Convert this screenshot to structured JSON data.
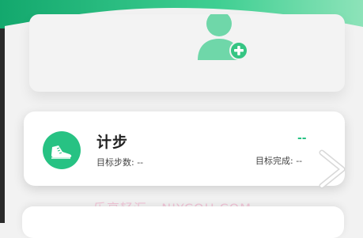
{
  "steps_card": {
    "title": "计步",
    "target_label": "目标步数: --",
    "complete_label": "目标完成: --",
    "value": "--",
    "icon": "sneaker-icon"
  },
  "watermark": "乐享轻汇 · NIYCOH.COM",
  "colors": {
    "accent": "#27c283",
    "header_dark": "#13a86d",
    "header_light": "#8de3b9"
  },
  "icons": {
    "avatar": "add-user-icon",
    "chevron": "chevron-right-icon"
  }
}
